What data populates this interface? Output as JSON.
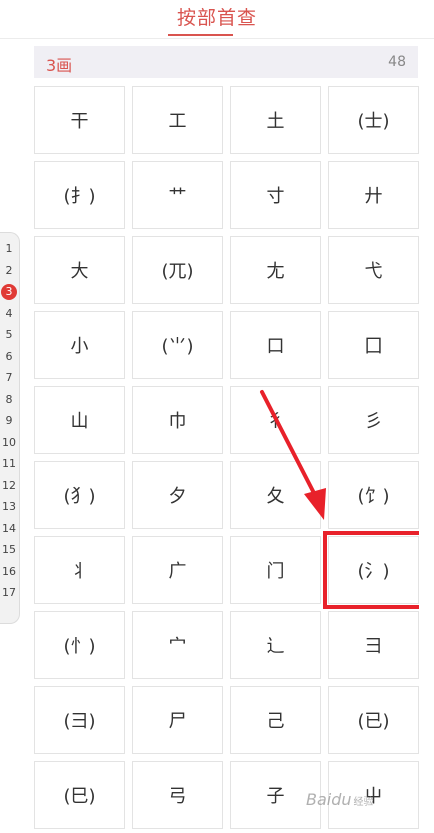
{
  "header": {
    "title": "按部首查"
  },
  "section": {
    "label": "3画",
    "count": "48"
  },
  "radicals": [
    "干",
    "工",
    "土",
    "(士)",
    "(扌)",
    "艹",
    "寸",
    "廾",
    "大",
    "(兀)",
    "尢",
    "弋",
    "小",
    "(⺌)",
    "口",
    "囗",
    "山",
    "巾",
    "彳",
    "彡",
    "(犭)",
    "夕",
    "夂",
    "(饣)",
    "丬",
    "广",
    "门",
    "(氵)",
    "(忄)",
    "宀",
    "辶",
    "彐",
    "(彐)",
    "尸",
    "己",
    "(已)",
    "(巳)",
    "弓",
    "子",
    "屮"
  ],
  "highlight_index": 27,
  "index_bar": {
    "items": [
      "1",
      "2",
      "3",
      "4",
      "5",
      "6",
      "7",
      "8",
      "9",
      "10",
      "11",
      "12",
      "13",
      "14",
      "15",
      "16",
      "17"
    ],
    "active": "3"
  },
  "colors": {
    "accent": "#d9544f",
    "annotation": "#e8212a"
  },
  "watermark": {
    "text": "Baidu",
    "sub": "经验"
  }
}
